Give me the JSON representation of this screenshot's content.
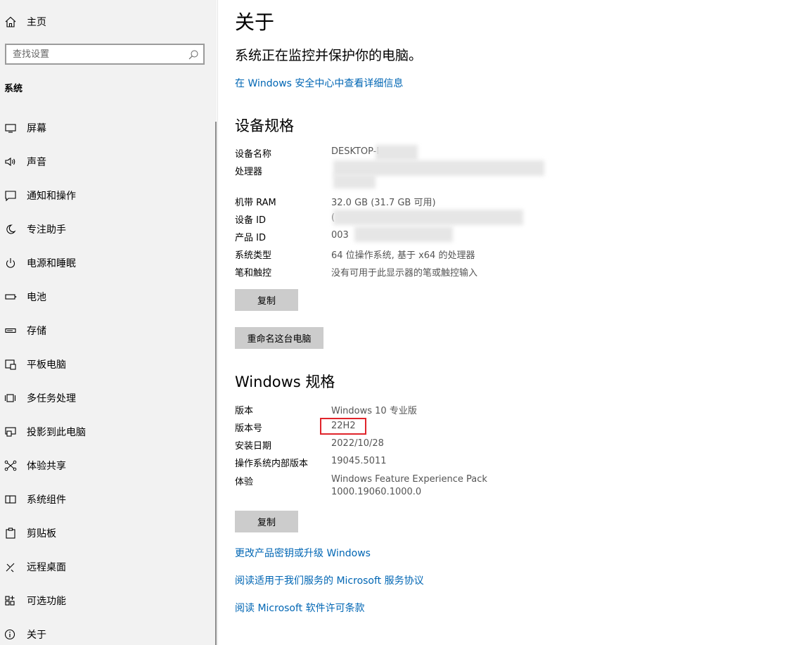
{
  "sidebar": {
    "home": {
      "label": "主页",
      "icon": "home-icon"
    },
    "search": {
      "placeholder": "查找设置",
      "icon": "search-icon"
    },
    "section": "系统",
    "items": [
      {
        "label": "屏幕",
        "icon": "display-icon"
      },
      {
        "label": "声音",
        "icon": "speaker-icon"
      },
      {
        "label": "通知和操作",
        "icon": "notification-icon"
      },
      {
        "label": "专注助手",
        "icon": "moon-icon"
      },
      {
        "label": "电源和睡眠",
        "icon": "power-icon"
      },
      {
        "label": "电池",
        "icon": "battery-icon"
      },
      {
        "label": "存储",
        "icon": "storage-icon"
      },
      {
        "label": "平板电脑",
        "icon": "tablet-icon"
      },
      {
        "label": "多任务处理",
        "icon": "multitasking-icon"
      },
      {
        "label": "投影到此电脑",
        "icon": "projecting-icon"
      },
      {
        "label": "体验共享",
        "icon": "share-experience-icon"
      },
      {
        "label": "系统组件",
        "icon": "system-components-icon"
      },
      {
        "label": "剪贴板",
        "icon": "clipboard-icon"
      },
      {
        "label": "远程桌面",
        "icon": "remote-desktop-icon"
      },
      {
        "label": "可选功能",
        "icon": "optional-features-icon"
      },
      {
        "label": "关于",
        "icon": "info-icon"
      }
    ]
  },
  "main": {
    "title": "关于",
    "status": "系统正在监控并保护你的电脑。",
    "security_link": "在 Windows 安全中心中查看详细信息",
    "device_specs": {
      "heading": "设备规格",
      "rows": [
        {
          "key": "设备名称",
          "value": "DESKTOP-I"
        },
        {
          "key": "处理器",
          "value": ""
        },
        {
          "key": "机带 RAM",
          "value": "32.0 GB (31.7 GB 可用)"
        },
        {
          "key": "设备 ID",
          "value": "("
        },
        {
          "key": "产品 ID",
          "value": "003"
        },
        {
          "key": "系统类型",
          "value": "64 位操作系统, 基于 x64 的处理器"
        },
        {
          "key": "笔和触控",
          "value": "没有可用于此显示器的笔或触控输入"
        }
      ],
      "copy_button": "复制",
      "rename_button": "重命名这台电脑"
    },
    "windows_specs": {
      "heading": "Windows 规格",
      "rows": [
        {
          "key": "版本",
          "value": "Windows 10 专业版"
        },
        {
          "key": "版本号",
          "value": "22H2"
        },
        {
          "key": "安装日期",
          "value": "2022/10/28"
        },
        {
          "key": "操作系统内部版本",
          "value": "19045.5011"
        },
        {
          "key": "体验",
          "value": "Windows Feature Experience Pack",
          "value2": "1000.19060.1000.0"
        }
      ],
      "copy_button": "复制"
    },
    "links": [
      "更改产品密钥或升级 Windows",
      "阅读适用于我们服务的 Microsoft 服务协议",
      "阅读 Microsoft 软件许可条款"
    ],
    "highlight_color": "#e0242b"
  }
}
